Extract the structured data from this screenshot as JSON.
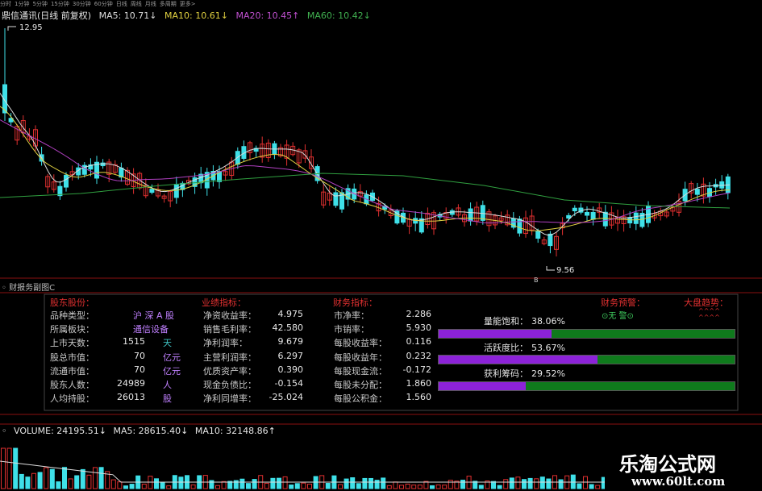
{
  "timeframes": [
    "分时",
    "1分钟",
    "5分钟",
    "15分钟",
    "30分钟",
    "60分钟",
    "日线",
    "周线",
    "月线",
    "多周期",
    "更多>"
  ],
  "header": {
    "stock": "鼎信通讯(日线 前复权)",
    "ma5": "MA5: 10.71↓",
    "ma10": "MA10: 10.61↓",
    "ma20": "MA20: 10.45↑",
    "ma60": "MA60: 10.42↓"
  },
  "price": {
    "high_label": "12.95",
    "low_label": "9.56",
    "low_marker": "B"
  },
  "colors": {
    "up": "#e03030",
    "down": "#3fe0e8",
    "ma5": "#dcdcdc",
    "ma10": "#e0d040",
    "ma20": "#b040c0",
    "ma60": "#30a040",
    "grid": "#8a1010"
  },
  "panel": {
    "title": "财报务副图C",
    "sections": {
      "shareholder": "股东股份：",
      "business": "业绩指标：",
      "finance": "财务指标：",
      "warning": "财务预警：",
      "market": "大盘趋势："
    },
    "warning_value": "⊙无 警⊙",
    "market_value": "^^^^\n^^^^",
    "col1": [
      {
        "label": "品种类型：",
        "value": "",
        "unit": "沪 深 A 股"
      },
      {
        "label": "所属板块：",
        "value": "",
        "unit": "通信设备"
      },
      {
        "label": "上市天数：",
        "value": "1515",
        "unit": "天"
      },
      {
        "label": "股总市值：",
        "value": "70",
        "unit": "亿元"
      },
      {
        "label": "流通市值：",
        "value": "70",
        "unit": "亿元"
      },
      {
        "label": "股东人数：",
        "value": "24989",
        "unit": "人"
      },
      {
        "label": "人均持股：",
        "value": "26013",
        "unit": "股"
      }
    ],
    "col2": [
      {
        "label": "净资收益率：",
        "value": "4.975"
      },
      {
        "label": "销售毛利率：",
        "value": "42.580"
      },
      {
        "label": "净利润率：",
        "value": "9.679"
      },
      {
        "label": "主营利润率：",
        "value": "6.297"
      },
      {
        "label": "优质资产率：",
        "value": "0.390"
      },
      {
        "label": "现金负债比：",
        "value": "-0.154"
      },
      {
        "label": "净利同增率：",
        "value": "-25.024"
      }
    ],
    "col3": [
      {
        "label": "市净率：",
        "value": "2.286"
      },
      {
        "label": "市销率：",
        "value": "5.930"
      },
      {
        "label": "每股收益率：",
        "value": "0.116"
      },
      {
        "label": "每股收益年：",
        "value": "0.232"
      },
      {
        "label": "每股现金流：",
        "value": "-0.172"
      },
      {
        "label": "每股未分配：",
        "value": "1.860"
      },
      {
        "label": "每股公积金：",
        "value": "1.560"
      }
    ],
    "bars": [
      {
        "label": "量能饱和：",
        "value": "38.06%",
        "fraction": 0.3806
      },
      {
        "label": "活跃度比：",
        "value": "53.67%",
        "fraction": 0.5367
      },
      {
        "label": "获利筹码：",
        "value": "29.52%",
        "fraction": 0.2952
      }
    ]
  },
  "volume": {
    "volume": "VOLUME: 24195.51↓",
    "ma5": "MA5: 28615.40↓",
    "ma10": "MA10: 32148.86↑"
  },
  "watermark": {
    "line1": "乐淘公式网",
    "line2": "www.60lt.com"
  }
}
